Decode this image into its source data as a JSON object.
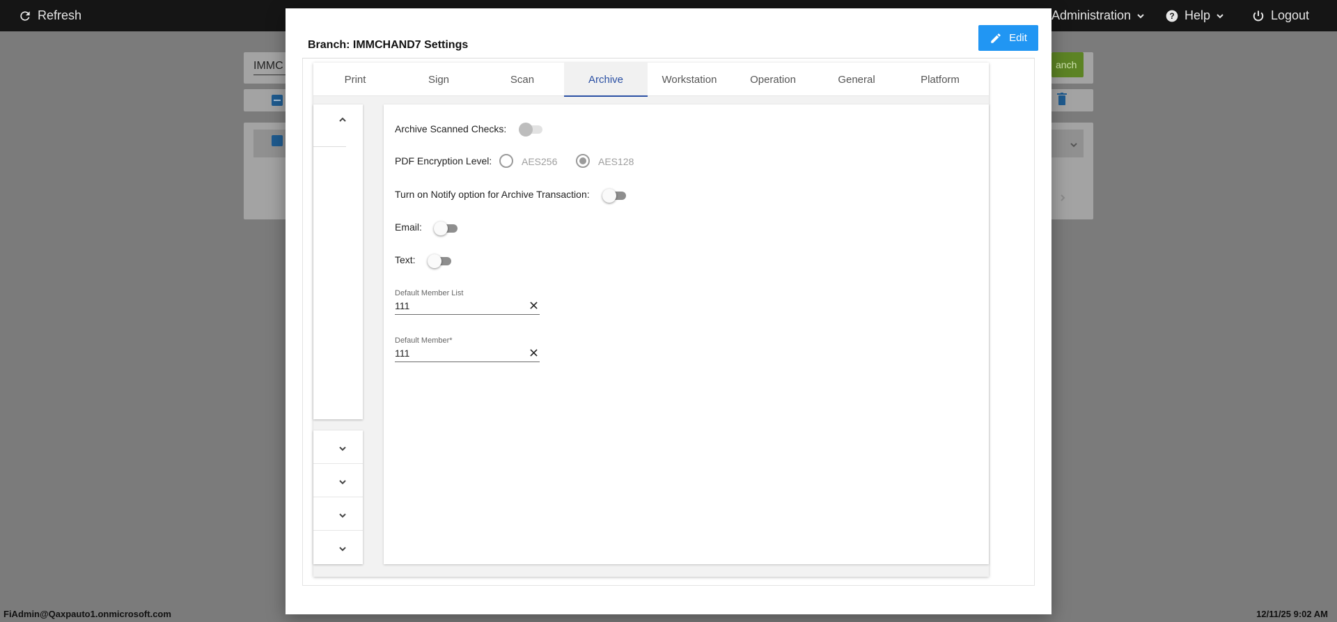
{
  "topbar": {
    "refresh_label": "Refresh",
    "administration_label": "Administration",
    "help_label": "Help",
    "logout_label": "Logout"
  },
  "background": {
    "search_value": "IMMC",
    "search_button_label": "anch"
  },
  "modal": {
    "title": "Branch: IMMCHAND7 Settings",
    "edit_label": "Edit",
    "tabs": [
      {
        "label": "Print"
      },
      {
        "label": "Sign"
      },
      {
        "label": "Scan"
      },
      {
        "label": "Archive"
      },
      {
        "label": "Workstation"
      },
      {
        "label": "Operation"
      },
      {
        "label": "General"
      },
      {
        "label": "Platform"
      }
    ],
    "active_tab": "Archive",
    "archive": {
      "archive_scanned_checks_label": "Archive Scanned Checks:",
      "archive_scanned_checks_on": false,
      "pdf_encryption_label": "PDF Encryption Level:",
      "pdf_options": [
        "AES256",
        "AES128"
      ],
      "pdf_selected": "AES128",
      "notify_label": "Turn on Notify option for Archive Transaction:",
      "notify_on": false,
      "email_label": "Email:",
      "email_on": false,
      "text_label": "Text:",
      "text_on": false,
      "default_member_list_label": "Default Member List",
      "default_member_list_value": "111",
      "default_member_label": "Default Member*",
      "default_member_value": "111"
    }
  },
  "statusbar": {
    "user": "FiAdmin@Qaxpauto1.onmicrosoft.com",
    "datetime": "12/11/25 9:02 AM"
  },
  "colors": {
    "accent": "#2196f3",
    "tab_active": "#2a4fa3",
    "topbar": "#151515",
    "overlay": "#7b7b7b"
  }
}
